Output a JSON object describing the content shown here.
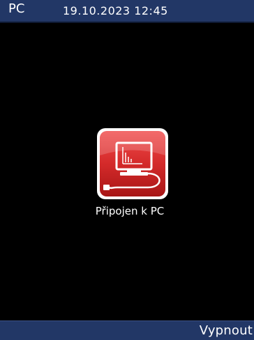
{
  "status_bar": {
    "mode": "PC",
    "datetime": "19.10.2023 12:45"
  },
  "main": {
    "icon": "pc-connection-icon",
    "label": "Připojen k PC"
  },
  "softkeys": {
    "right": "Vypnout"
  },
  "colors": {
    "bar_background": "#223766",
    "icon_red": "#d42a2a",
    "screen_background": "#000000"
  }
}
